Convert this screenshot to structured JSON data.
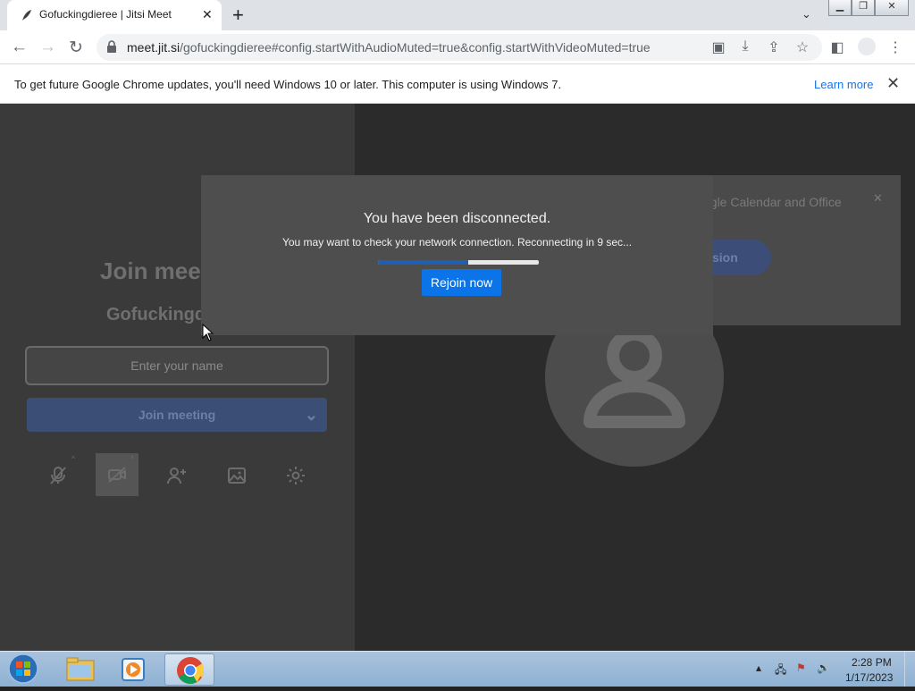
{
  "browser": {
    "tab_title": "Gofuckingdieree | Jitsi Meet",
    "tab_close": "✕",
    "new_tab": "+",
    "url_host": "meet.jit.si",
    "url_path": "/gofuckingdieree#config.startWithAudioMuted=true&config.startWithVideoMuted=true"
  },
  "infobar": {
    "message": "To get future Google Chrome updates, you'll need Windows 10 or later. This computer is using Windows 7.",
    "link": "Learn more",
    "close": "✕"
  },
  "prejoin": {
    "title": "Join meet",
    "room_name": "Gofuckingd",
    "name_placeholder": "Enter your name",
    "join_label": "Join meeting"
  },
  "banner": {
    "text": "ogle Calendar and Office",
    "button": "sion"
  },
  "dialog": {
    "title": "You have been disconnected.",
    "message": "You may want to check your network connection. Reconnecting in 9 sec...",
    "rejoin_label": "Rejoin now",
    "progress": 0.56
  },
  "taskbar": {
    "time": "2:28 PM",
    "date": "1/17/2023"
  },
  "colors": {
    "accent": "#0a74e8",
    "page_bg": "#2b2b2b",
    "left_panel": "#3a3a3a"
  }
}
